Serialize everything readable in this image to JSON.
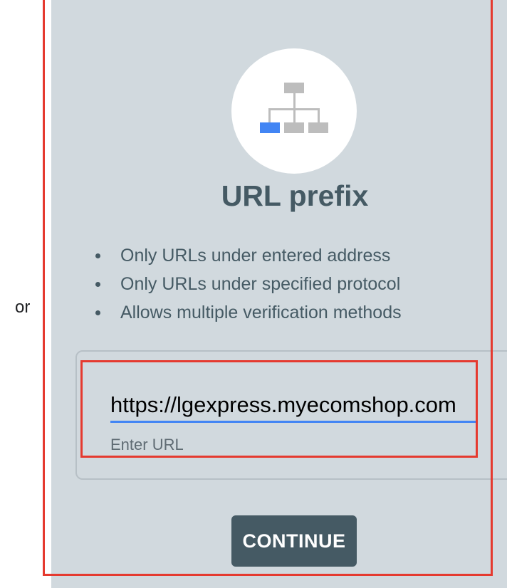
{
  "separator": {
    "or_label": "or"
  },
  "card": {
    "title": "URL prefix",
    "icon": "sitemap-hierarchy-icon",
    "features": [
      "Only URLs under entered address",
      "Only URLs under specified protocol",
      "Allows multiple verification methods"
    ],
    "url_input": {
      "value": "https://lgexpress.myecomshop.com",
      "helper": "Enter URL"
    },
    "continue_label": "CONTINUE"
  },
  "colors": {
    "card_background": "#d1d9de",
    "accent_blue": "#4285f4",
    "title_text": "#455a64",
    "button_background": "#455a64",
    "highlight_red": "#e53a2f"
  }
}
